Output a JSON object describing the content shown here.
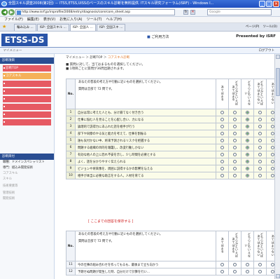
{
  "window": {
    "title": "全国スキル調査2008(第2回) － ITSS,ETSS,UISSのベースのスキル診断を無料提供. ITスキル研究フォーラム(iSRF) - Windows I...",
    "buttons": [
      "_",
      "□",
      "×"
    ]
  },
  "addressbar": {
    "url": "http://www.isrf.jp/irsprofile/2008/entry/diagnosis/core/core_sheet.asp",
    "search_placeholder": "Google"
  },
  "menubar": [
    "ファイル(F)",
    "編集(E)",
    "表示(V)",
    "お気に入り(A)",
    "ツール(T)",
    "ヘルプ(H)"
  ],
  "tabs": [
    "輪み込み ...",
    "ISP: 全国スキル ...",
    "ISP: 全国人 ...",
    "ISP: 全国スキ ..."
  ],
  "tab_tools": [
    "ページ(P)",
    "ツール(O)"
  ],
  "header": {
    "logo": "ETSS-DS",
    "usage_link": "ご利用方法",
    "presented_by": "Presented by iSRF",
    "mymenu": "マイメニュー",
    "logout": "ログアウト"
  },
  "sidebar": {
    "section1": "診断項目",
    "items": [
      {
        "label": "診断TOP",
        "style": "red"
      },
      {
        "label": "コアスキル",
        "style": "orange"
      },
      {
        "label": "",
        "style": "red"
      },
      {
        "label": "",
        "style": "red"
      },
      {
        "label": "",
        "style": "red"
      },
      {
        "label": "",
        "style": "red"
      },
      {
        "label": "",
        "style": "red"
      },
      {
        "label": "",
        "style": "red"
      }
    ],
    "section2": "診断目付",
    "info": [
      {
        "label": "職種：ドメインスペシャリスト",
        "dim": false
      },
      {
        "label": "専門：組込み開発技術",
        "dim": false
      },
      {
        "label": "コアスキル",
        "dim": true
      },
      {
        "label": "スキル",
        "dim": true
      },
      {
        "label": "",
        "dim": true
      },
      {
        "label": "技術要素等",
        "dim": true
      },
      {
        "label": "",
        "dim": true
      },
      {
        "label": "管理技術",
        "dim": true
      },
      {
        "label": "開発技術",
        "dim": true
      },
      {
        "label": "",
        "dim": true
      }
    ]
  },
  "breadcrumb": {
    "part1": "マイメニュー",
    "sep": " ＞ ",
    "part2": "診断TOP",
    "part3": "コアスキル診断"
  },
  "instructions": [
    "■ 質問に対して、当てはまるものを選択してください。",
    "■ 1項目ごとに質問が36問出題されます。"
  ],
  "question_header": {
    "no": "No.",
    "prompt": "あなたの普段の考え方や行動に近いものを選択してください。",
    "count": "質問は全部で 72 問です。",
    "options": [
      "あてはまる",
      "どちらかといえばあてはまる",
      "どちらともいえない",
      "どちらかといえばあてはまらない",
      "あてはまらない"
    ]
  },
  "questions_page1": [
    {
      "no": "1",
      "text": "自分は常に考えた人とも、分け隔てなく付き合う",
      "selected": 2
    },
    {
      "no": "2",
      "text": "仕事に悩む人を見ることを心配し合い、力になる",
      "selected": 2
    },
    {
      "no": "3",
      "text": "論理的で説得力にあふれた話を相手が行う",
      "selected": 2
    },
    {
      "no": "4",
      "text": "部下や同僚のやる気と能力を考えて、仕事を割振る",
      "selected": 2
    },
    {
      "no": "5",
      "text": "誰も気付かない中、将来予測されるリスクを把握する",
      "selected": 2
    },
    {
      "no": "6",
      "text": "問題する組織の目的を踏襲し、改変行動しかない",
      "selected": 2
    },
    {
      "no": "7",
      "text": "有効な他人の上に恐れ不安を示し、少し時間を必要とする",
      "selected": 2
    },
    {
      "no": "8",
      "text": "よく、話を分かりやすく伝えられる",
      "selected": 2
    },
    {
      "no": "9",
      "text": "ビジョンや将来像を、周囲に説得するかの影響を与える",
      "selected": 2
    },
    {
      "no": "10",
      "text": "相手が本当に必要な助言をする人。人材を育てる",
      "selected": 2
    }
  ],
  "save_link": "[ ここまでの回答を保存する ]",
  "questions_page2": [
    {
      "no": "11",
      "text": "今の仕事の組み合わせを作ってもるも、最後まで立ち向かう",
      "selected": -1
    },
    {
      "no": "12",
      "text": "予期せぬ問題が発生した時、自分だけで計算を行い...",
      "selected": -1
    }
  ]
}
